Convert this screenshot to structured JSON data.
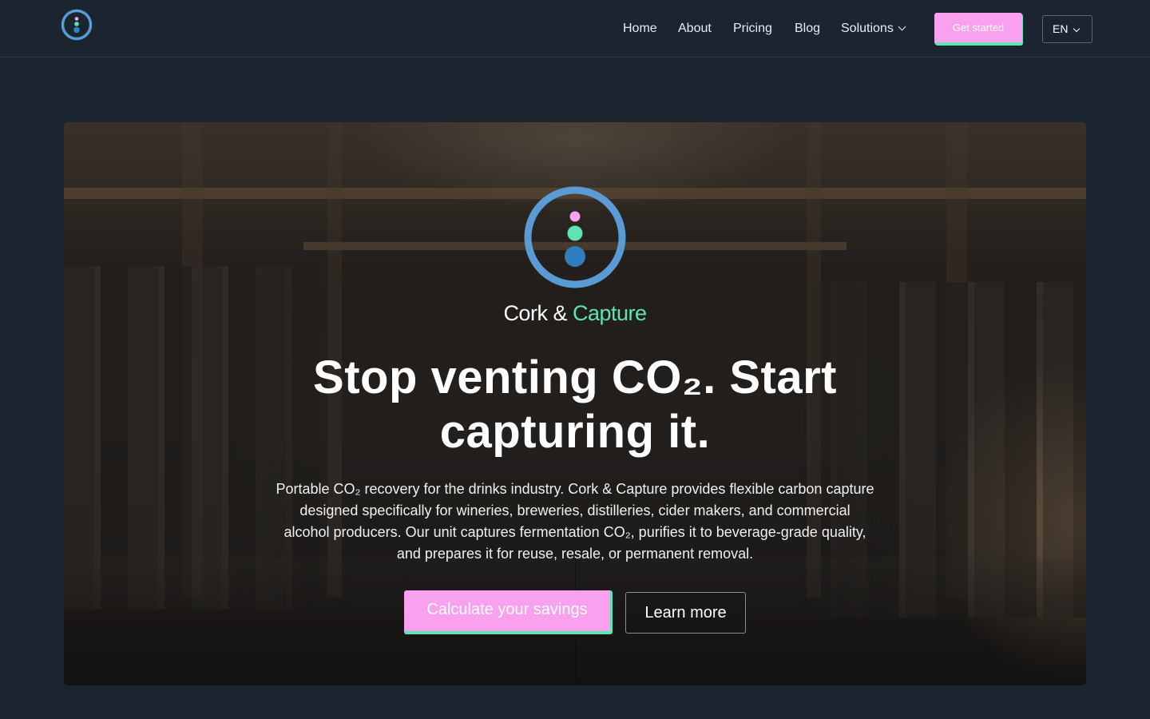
{
  "header": {
    "logo_icon": "cork-and-capture-logo-icon",
    "nav": {
      "home": "Home",
      "about": "About",
      "pricing": "Pricing",
      "blog": "Blog",
      "solutions": "Solutions"
    },
    "cta_label": "Get started",
    "language": "EN"
  },
  "hero": {
    "brand_part1": "Cork &",
    "brand_part2": "Capture",
    "headline": "Stop venting CO₂. Start capturing it.",
    "subtext": "Portable CO₂ recovery for the drinks industry. Cork & Capture provides flexible carbon capture designed specifically for wineries, breweries, distilleries, cider makers, and commercial alcohol producers. Our unit captures fermentation CO₂, purifies it to beverage-grade quality, and prepares it for reuse, resale, or permanent removal.",
    "primary_button": "Calculate your savings",
    "secondary_button": "Learn more"
  },
  "colors": {
    "background": "#1b2530",
    "accent_pink": "#f9a0ef",
    "accent_green": "#5ee3b3",
    "logo_blue": "#5b9bd5",
    "logo_dot_blue": "#2f7fc0"
  }
}
